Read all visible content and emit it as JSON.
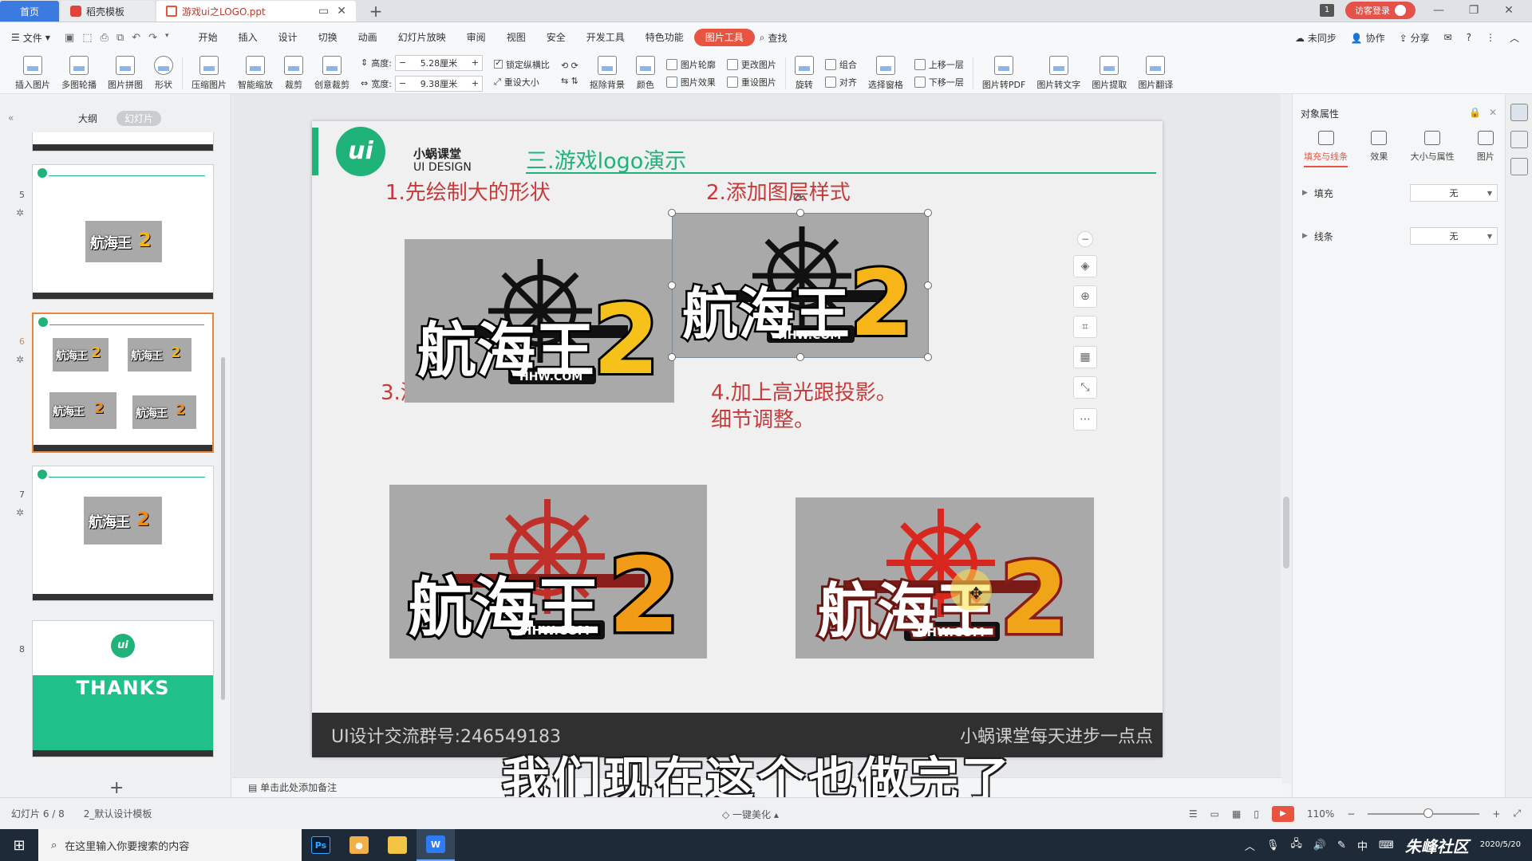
{
  "tabs": {
    "home": "首页",
    "docer": "稻壳模板",
    "document": "游戏ui之LOGO.ppt"
  },
  "titlebar": {
    "window_count": "1",
    "login": "访客登录"
  },
  "menu": {
    "file": "文件",
    "items": [
      "开始",
      "插入",
      "设计",
      "切换",
      "动画",
      "幻灯片放映",
      "审阅",
      "视图",
      "安全",
      "开发工具",
      "特色功能"
    ],
    "active": "图片工具",
    "search": "查找",
    "right": [
      "未同步",
      "协作",
      "分享"
    ]
  },
  "ribbon": {
    "insert_picture": "插入图片",
    "multi_contour": "多图轮播",
    "picture_puzzle": "图片拼图",
    "shape": "形状",
    "compress": "压缩图片",
    "smart_scale": "智能缩放",
    "crop": "裁剪",
    "creative_crop": "创意裁剪",
    "height_label": "高度:",
    "height_value": "5.28厘米",
    "width_label": "宽度:",
    "width_value": "9.38厘米",
    "lock_ratio": "锁定纵横比",
    "reset_size": "重设大小",
    "remove_bg": "抠除背景",
    "color": "颜色",
    "picture_outline": "图片轮廓",
    "picture_effect": "图片效果",
    "change_picture": "更改图片",
    "reset_picture": "重设图片",
    "rotate": "旋转",
    "group": "组合",
    "align": "对齐",
    "selection_pane": "选择窗格",
    "bring_forward": "上移一层",
    "send_backward": "下移一层",
    "to_pdf": "图片转PDF",
    "to_text": "图片转文字",
    "extract": "图片提取",
    "translate": "图片翻译"
  },
  "left_panel": {
    "tab_outline": "大纲",
    "tab_slides": "幻灯片",
    "slide_numbers": [
      "5",
      "6",
      "7",
      "8"
    ],
    "thanks": "THANKS"
  },
  "slide": {
    "brand_cn": "小蜗课堂",
    "brand_en": "UI DESIGN",
    "title": "三.游戏logo演示",
    "step1": "1.先绘制大的形状",
    "step2": "2.添加图层样式",
    "step3": "3.添加细节",
    "step4_line1": "4.加上高光跟投影。",
    "step4_line2": "细节调整。",
    "logo_text": "航海王",
    "logo_num": "2",
    "logo_url": "HHW.COM",
    "footer_left": "UI设计交流群号:246549183",
    "footer_right": "小蜗课堂每天进步一点点"
  },
  "subtitle": "我们现在这个也做完了",
  "notes_placeholder": "单击此处添加备注",
  "right_panel": {
    "title": "对象属性",
    "tabs": [
      "填充与线条",
      "效果",
      "大小与属性",
      "图片"
    ],
    "fill_label": "填充",
    "fill_value": "无",
    "line_label": "线条",
    "line_value": "无"
  },
  "status": {
    "slide_info": "幻灯片 6 / 8",
    "template": "2_默认设计模板",
    "beautify": "一键美化",
    "zoom": "110%"
  },
  "taskbar": {
    "search_placeholder": "在这里输入你要搜索的内容",
    "ime": "中",
    "watermark": "朱峰社区",
    "date": "2020/5/20"
  },
  "colors": {
    "brand_green": "#1fb37a",
    "accent_red": "#c73a3a",
    "tool_tab": "#e8543f"
  }
}
